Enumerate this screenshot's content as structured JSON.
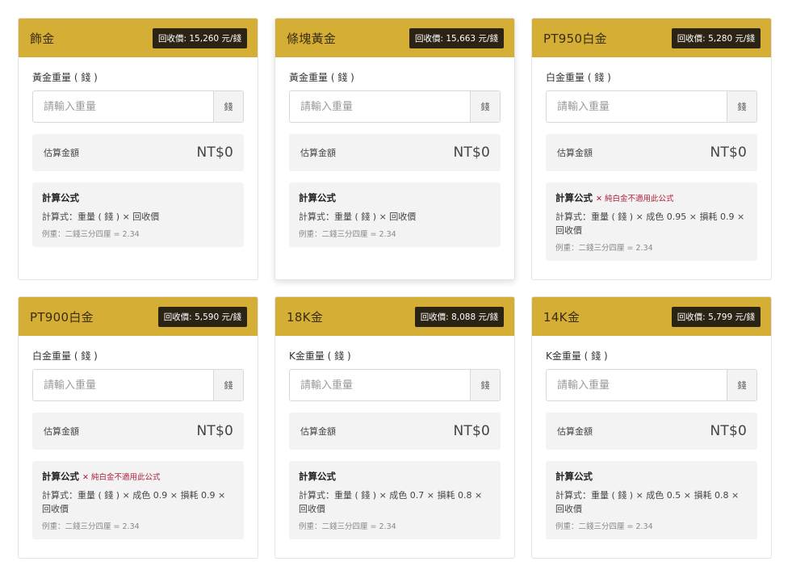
{
  "cards": [
    {
      "title": "飾金",
      "price": "回收價: 15,260 元/錢",
      "weight_label": "黃金重量 ( 錢 )",
      "placeholder": "請輸入重量",
      "unit": "錢",
      "estimate_label": "估算金額",
      "estimate_value": "NT$0",
      "formula_title": "計算公式",
      "formula_warning": "",
      "formula": "計算式：重量 ( 錢 ) × 回收價",
      "example": "例重：二錢三分四厘 = 2.34"
    },
    {
      "title": "條塊黃金",
      "price": "回收價: 15,663 元/錢",
      "weight_label": "黃金重量 ( 錢 )",
      "placeholder": "請輸入重量",
      "unit": "錢",
      "estimate_label": "估算金額",
      "estimate_value": "NT$0",
      "formula_title": "計算公式",
      "formula_warning": "",
      "formula": "計算式：重量 ( 錢 ) × 回收價",
      "example": "例重：二錢三分四厘 = 2.34"
    },
    {
      "title": "PT950白金",
      "price": "回收價: 5,280 元/錢",
      "weight_label": "白金重量 ( 錢 )",
      "placeholder": "請輸入重量",
      "unit": "錢",
      "estimate_label": "估算金額",
      "estimate_value": "NT$0",
      "formula_title": "計算公式",
      "formula_warning": "✕ 純白金不適用此公式",
      "formula": "計算式：重量 ( 錢 ) × 成色 0.95 × 損耗 0.9 × 回收價",
      "example": "例重：二錢三分四厘 = 2.34"
    },
    {
      "title": "PT900白金",
      "price": "回收價: 5,590 元/錢",
      "weight_label": "白金重量 ( 錢 )",
      "placeholder": "請輸入重量",
      "unit": "錢",
      "estimate_label": "估算金額",
      "estimate_value": "NT$0",
      "formula_title": "計算公式",
      "formula_warning": "✕ 純白金不適用此公式",
      "formula": "計算式：重量 ( 錢 ) × 成色 0.9 × 損耗 0.9 × 回收價",
      "example": "例重：二錢三分四厘 = 2.34"
    },
    {
      "title": "18K金",
      "price": "回收價: 8,088 元/錢",
      "weight_label": "K金重量 ( 錢 )",
      "placeholder": "請輸入重量",
      "unit": "錢",
      "estimate_label": "估算金額",
      "estimate_value": "NT$0",
      "formula_title": "計算公式",
      "formula_warning": "",
      "formula": "計算式：重量 ( 錢 ) × 成色 0.7 × 損耗 0.8 × 回收價",
      "example": "例重：二錢三分四厘 = 2.34"
    },
    {
      "title": "14K金",
      "price": "回收價: 5,799 元/錢",
      "weight_label": "K金重量 ( 錢 )",
      "placeholder": "請輸入重量",
      "unit": "錢",
      "estimate_label": "估算金額",
      "estimate_value": "NT$0",
      "formula_title": "計算公式",
      "formula_warning": "",
      "formula": "計算式：重量 ( 錢 ) × 成色 0.5 × 損耗 0.8 × 回收價",
      "example": "例重：二錢三分四厘 = 2.34"
    }
  ]
}
